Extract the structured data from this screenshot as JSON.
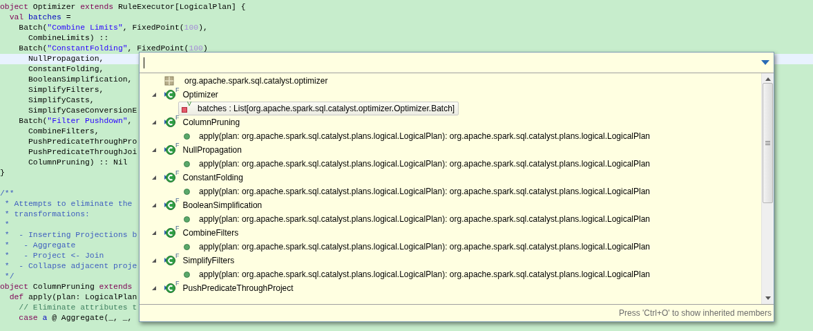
{
  "editor": {
    "lines": [
      {
        "current": false,
        "tokens": [
          {
            "kind": "keyword",
            "text": "object"
          },
          {
            "kind": "plain",
            "text": " Optimizer "
          },
          {
            "kind": "keyword",
            "text": "extends"
          },
          {
            "kind": "plain",
            "text": " RuleExecutor[LogicalPlan] {"
          }
        ]
      },
      {
        "current": false,
        "tokens": [
          {
            "kind": "keyword",
            "text": "  val"
          },
          {
            "kind": "field",
            "text": " batches"
          },
          {
            "kind": "plain",
            "text": " ="
          }
        ]
      },
      {
        "current": false,
        "tokens": [
          {
            "kind": "plain",
            "text": "    Batch("
          },
          {
            "kind": "string",
            "text": "\"Combine Limits\""
          },
          {
            "kind": "plain",
            "text": ", FixedPoint("
          },
          {
            "kind": "number",
            "text": "100"
          },
          {
            "kind": "plain",
            "text": "),"
          }
        ]
      },
      {
        "current": false,
        "tokens": [
          {
            "kind": "plain",
            "text": "      CombineLimits) ::"
          }
        ]
      },
      {
        "current": false,
        "tokens": [
          {
            "kind": "plain",
            "text": "    Batch("
          },
          {
            "kind": "string",
            "text": "\"ConstantFolding\""
          },
          {
            "kind": "plain",
            "text": ", FixedPoint("
          },
          {
            "kind": "number",
            "text": "100"
          },
          {
            "kind": "plain",
            "text": ")"
          }
        ]
      },
      {
        "current": true,
        "tokens": [
          {
            "kind": "plain",
            "text": "      NullPropagation,"
          }
        ]
      },
      {
        "current": false,
        "tokens": [
          {
            "kind": "plain",
            "text": "      ConstantFolding,"
          }
        ]
      },
      {
        "current": false,
        "tokens": [
          {
            "kind": "plain",
            "text": "      BooleanSimplification,"
          }
        ]
      },
      {
        "current": false,
        "tokens": [
          {
            "kind": "plain",
            "text": "      SimplifyFilters,"
          }
        ]
      },
      {
        "current": false,
        "tokens": [
          {
            "kind": "plain",
            "text": "      SimplifyCasts,"
          }
        ]
      },
      {
        "current": false,
        "tokens": [
          {
            "kind": "plain",
            "text": "      SimplifyCaseConversionE"
          }
        ]
      },
      {
        "current": false,
        "tokens": [
          {
            "kind": "plain",
            "text": "    Batch("
          },
          {
            "kind": "string",
            "text": "\"Filter Pushdown\""
          },
          {
            "kind": "plain",
            "text": ","
          }
        ]
      },
      {
        "current": false,
        "tokens": [
          {
            "kind": "plain",
            "text": "      CombineFilters,"
          }
        ]
      },
      {
        "current": false,
        "tokens": [
          {
            "kind": "plain",
            "text": "      PushPredicateThroughPro"
          }
        ]
      },
      {
        "current": false,
        "tokens": [
          {
            "kind": "plain",
            "text": "      PushPredicateThroughJoi"
          }
        ]
      },
      {
        "current": false,
        "tokens": [
          {
            "kind": "plain",
            "text": "      ColumnPruning) :: Nil"
          }
        ]
      },
      {
        "current": false,
        "tokens": [
          {
            "kind": "plain",
            "text": "}"
          }
        ]
      },
      {
        "current": false
      },
      {
        "current": false,
        "tokens": [
          {
            "kind": "doc",
            "text": "/**"
          }
        ]
      },
      {
        "current": false,
        "tokens": [
          {
            "kind": "doc",
            "text": " * Attempts to eliminate the"
          }
        ]
      },
      {
        "current": false,
        "tokens": [
          {
            "kind": "doc",
            "text": " * transformations:"
          }
        ]
      },
      {
        "current": false,
        "tokens": [
          {
            "kind": "doc",
            "text": " *"
          }
        ]
      },
      {
        "current": false,
        "tokens": [
          {
            "kind": "doc",
            "text": " *  - Inserting Projections b"
          }
        ]
      },
      {
        "current": false,
        "tokens": [
          {
            "kind": "doc",
            "text": " *   - Aggregate"
          }
        ]
      },
      {
        "current": false,
        "tokens": [
          {
            "kind": "doc",
            "text": " *   - Project <- Join"
          }
        ]
      },
      {
        "current": false,
        "tokens": [
          {
            "kind": "doc",
            "text": " *  - Collapse adjacent proje"
          }
        ]
      },
      {
        "current": false,
        "tokens": [
          {
            "kind": "doc",
            "text": " */"
          }
        ]
      },
      {
        "current": false,
        "tokens": [
          {
            "kind": "keyword",
            "text": "object"
          },
          {
            "kind": "plain",
            "text": " ColumnPruning "
          },
          {
            "kind": "keyword",
            "text": "extends"
          }
        ]
      },
      {
        "current": false,
        "tokens": [
          {
            "kind": "keyword",
            "text": "  def"
          },
          {
            "kind": "plain",
            "text": " apply(plan: LogicalPlan"
          }
        ]
      },
      {
        "current": false,
        "tokens": [
          {
            "kind": "comment",
            "text": "    // Eliminate attributes t"
          }
        ]
      },
      {
        "current": false,
        "tokens": [
          {
            "kind": "keyword",
            "text": "    case"
          },
          {
            "kind": "field",
            "text": " a"
          },
          {
            "kind": "plain",
            "text": " @ Aggregate(_, _,"
          }
        ]
      }
    ]
  },
  "outline": {
    "items": [
      {
        "kind": "package",
        "label": "org.apache.spark.sql.catalyst.optimizer",
        "selected": false
      },
      {
        "kind": "class",
        "label": "Optimizer",
        "modifier": "F",
        "expanded": true,
        "selected": false,
        "children": [
          {
            "kind": "field",
            "label": "batches : List[org.apache.spark.sql.catalyst.optimizer.Optimizer.Batch]",
            "modifier": "V",
            "selected": true
          }
        ]
      },
      {
        "kind": "class",
        "label": "ColumnPruning",
        "modifier": "F",
        "expanded": true,
        "selected": false,
        "children": [
          {
            "kind": "method",
            "label": "apply(plan: org.apache.spark.sql.catalyst.plans.logical.LogicalPlan): org.apache.spark.sql.catalyst.plans.logical.LogicalPlan",
            "selected": false
          }
        ]
      },
      {
        "kind": "class",
        "label": "NullPropagation",
        "modifier": "F",
        "expanded": true,
        "selected": false,
        "children": [
          {
            "kind": "method",
            "label": "apply(plan: org.apache.spark.sql.catalyst.plans.logical.LogicalPlan): org.apache.spark.sql.catalyst.plans.logical.LogicalPlan",
            "selected": false
          }
        ]
      },
      {
        "kind": "class",
        "label": "ConstantFolding",
        "modifier": "F",
        "expanded": true,
        "selected": false,
        "children": [
          {
            "kind": "method",
            "label": "apply(plan: org.apache.spark.sql.catalyst.plans.logical.LogicalPlan): org.apache.spark.sql.catalyst.plans.logical.LogicalPlan",
            "selected": false
          }
        ]
      },
      {
        "kind": "class",
        "label": "BooleanSimplification",
        "modifier": "F",
        "expanded": true,
        "selected": false,
        "children": [
          {
            "kind": "method",
            "label": "apply(plan: org.apache.spark.sql.catalyst.plans.logical.LogicalPlan): org.apache.spark.sql.catalyst.plans.logical.LogicalPlan",
            "selected": false
          }
        ]
      },
      {
        "kind": "class",
        "label": "CombineFilters",
        "modifier": "F",
        "expanded": true,
        "selected": false,
        "children": [
          {
            "kind": "method",
            "label": "apply(plan: org.apache.spark.sql.catalyst.plans.logical.LogicalPlan): org.apache.spark.sql.catalyst.plans.logical.LogicalPlan",
            "selected": false
          }
        ]
      },
      {
        "kind": "class",
        "label": "SimplifyFilters",
        "modifier": "F",
        "expanded": true,
        "selected": false,
        "children": [
          {
            "kind": "method",
            "label": "apply(plan: org.apache.spark.sql.catalyst.plans.logical.LogicalPlan): org.apache.spark.sql.catalyst.plans.logical.LogicalPlan",
            "selected": false
          }
        ]
      },
      {
        "kind": "class",
        "label": "PushPredicateThroughProject",
        "modifier": "F",
        "expanded": true,
        "selected": false
      }
    ],
    "hint": "Press 'Ctrl+O' to show inherited members"
  }
}
